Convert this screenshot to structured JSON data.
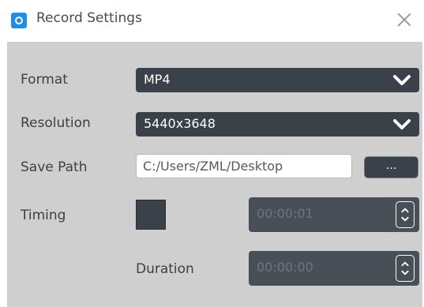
{
  "window": {
    "title": "Record Settings",
    "accent": "#1e8fe8",
    "icon": "app-record-icon",
    "close_icon": "close-icon"
  },
  "form": {
    "format": {
      "label": "Format",
      "value": "MP4"
    },
    "resolution": {
      "label": "Resolution",
      "value": "5440x3648"
    },
    "save_path": {
      "label": "Save Path",
      "value": "C:/Users/ZML/Desktop",
      "browse_label": "..."
    },
    "timing": {
      "label": "Timing",
      "checked": false,
      "value": "00:00:01"
    },
    "duration": {
      "label": "Duration",
      "value": "00:00:00"
    }
  }
}
